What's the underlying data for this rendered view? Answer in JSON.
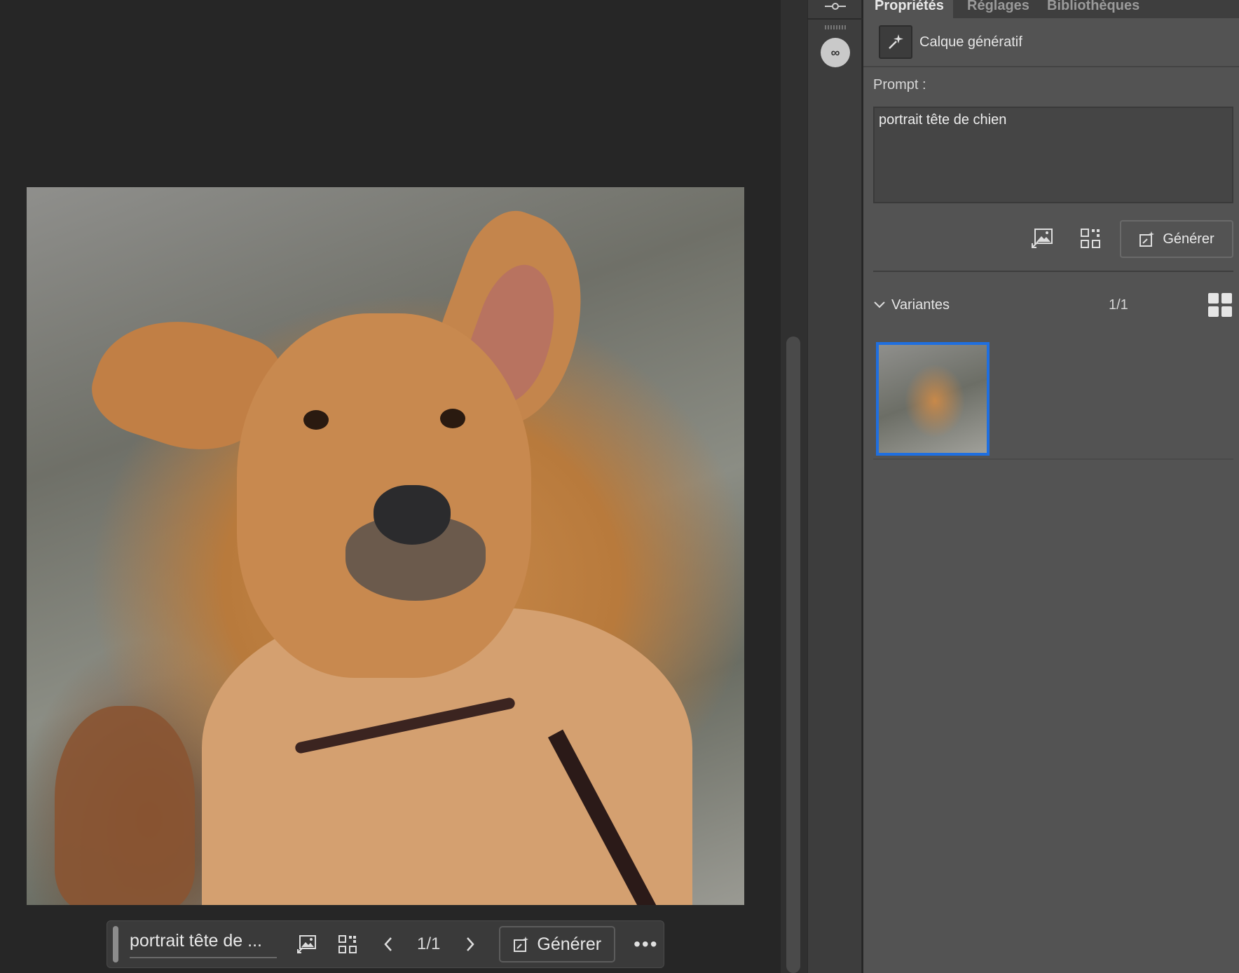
{
  "canvas": {
    "image_description_name": "generated-dog-portrait",
    "taskbar": {
      "prompt_preview": "portrait tête de ...",
      "variant_count": "1/1",
      "generate_label": "Générer",
      "more_label": "•••",
      "icons": [
        "reference-image-icon",
        "effects-icon",
        "previous-icon",
        "next-icon",
        "generate-icon"
      ]
    }
  },
  "panel": {
    "tabs": [
      "Propriétés",
      "Réglages",
      "Bibliothèques"
    ],
    "active_tab": "Propriétés",
    "layer_name": "Calque génératif",
    "prompt_label": "Prompt :",
    "prompt_value": "portrait tête de chien",
    "generate_label": "Générer",
    "variants_label": "Variantes",
    "variants_count": "1/1",
    "selected_variant": 1
  },
  "colors": {
    "panel_bg": "#535353",
    "canvas_bg": "#262626",
    "accent_selection": "#1f6fe0"
  }
}
